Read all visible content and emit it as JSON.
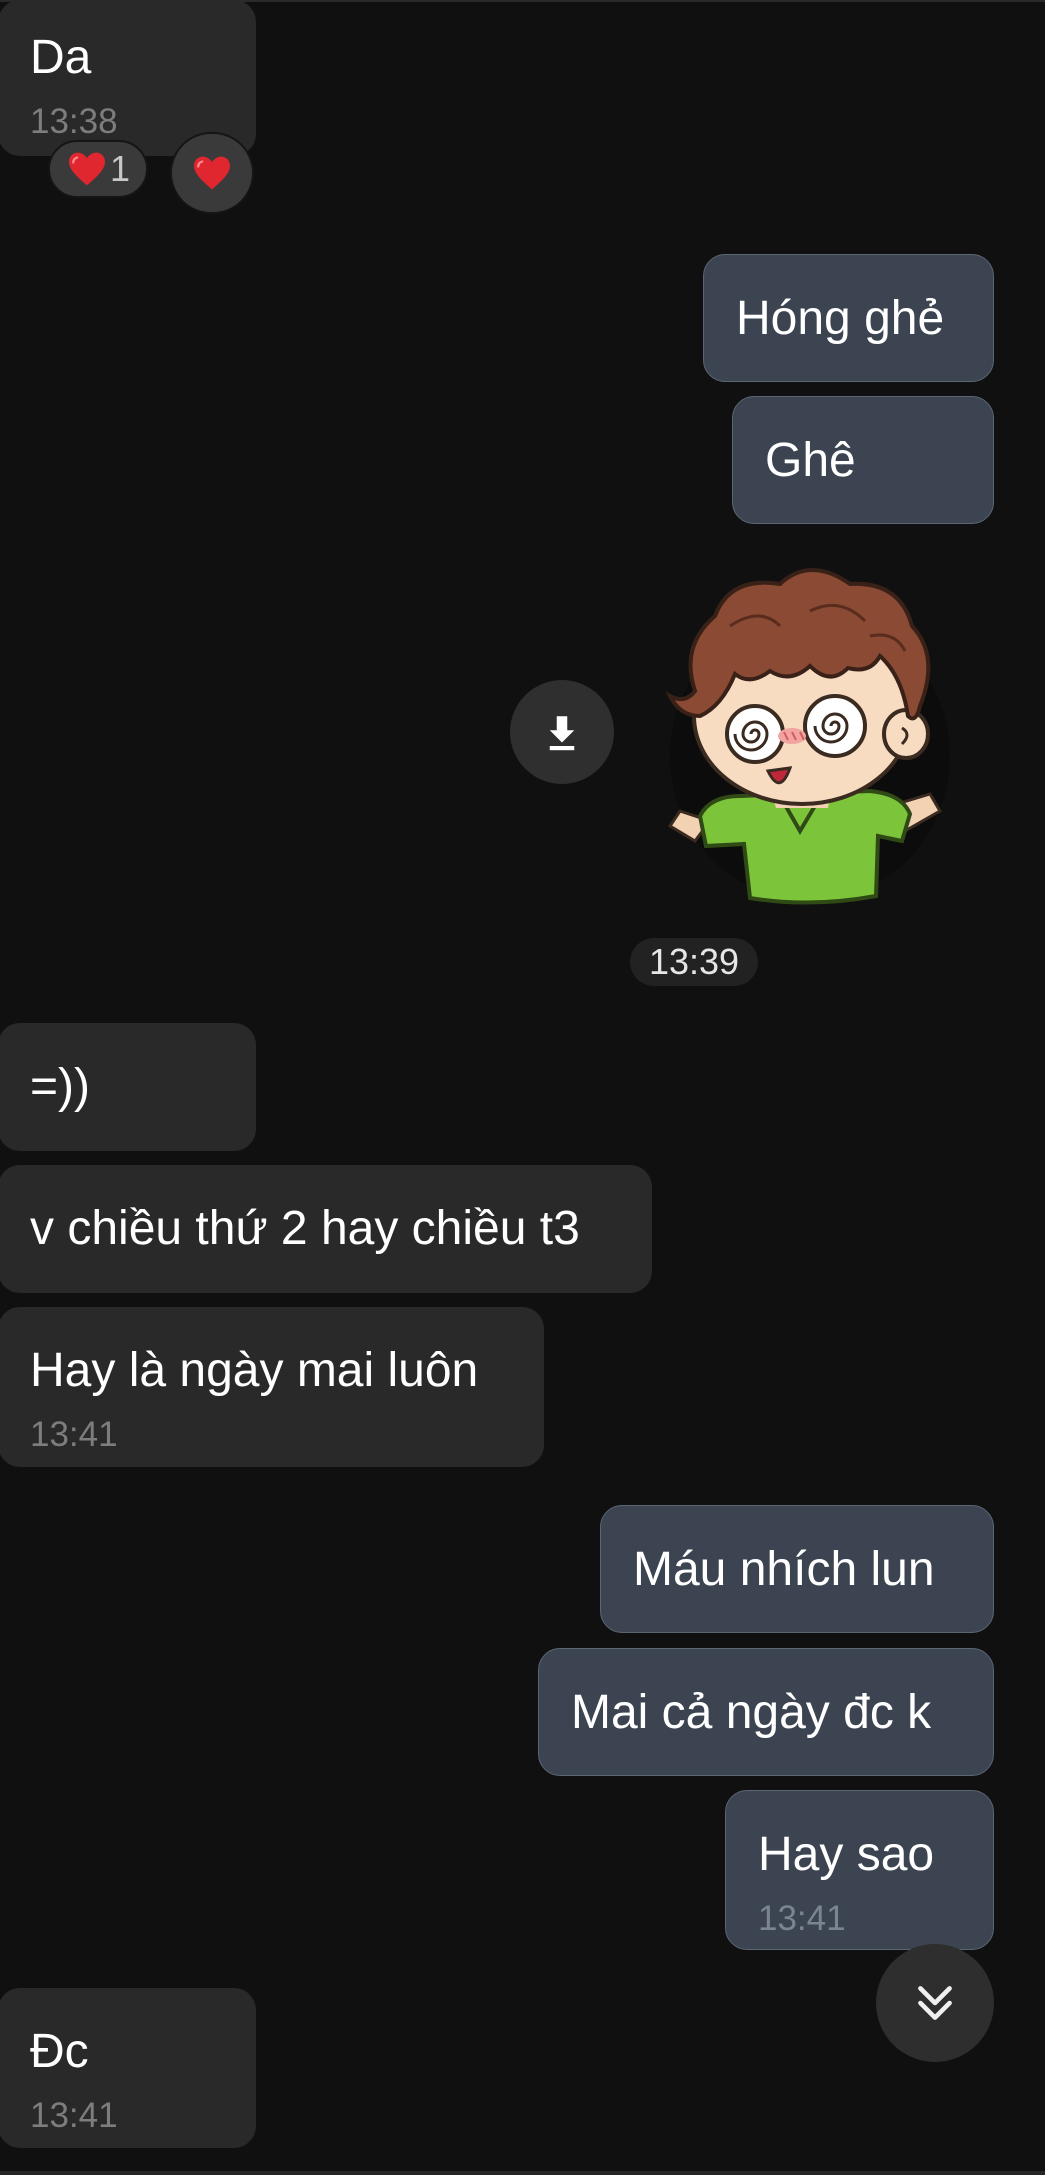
{
  "messages": [
    {
      "text": "Da",
      "time": "13:38"
    },
    {
      "text": "Hóng ghẻ"
    },
    {
      "text": "Ghê"
    },
    {
      "text": "=))"
    },
    {
      "text": "v chiều thứ 2 hay chiều t3"
    },
    {
      "text": "Hay là ngày mai luôn",
      "time": "13:41"
    },
    {
      "text": "Máu nhích lun"
    },
    {
      "text": "Mai cả ngày đc k"
    },
    {
      "text": "Hay sao",
      "time": "13:41"
    },
    {
      "text": "Đc",
      "time": "13:41"
    }
  ],
  "reactions": {
    "heart_count": "1"
  },
  "sticker_time": "13:39",
  "icons": {
    "download": "download-icon",
    "scroll_down": "double-chevron-down-icon",
    "reaction": "heart-icon"
  },
  "colors": {
    "background": "#101010",
    "incoming_bubble": "#292929",
    "outgoing_bubble": "#3b4450"
  }
}
